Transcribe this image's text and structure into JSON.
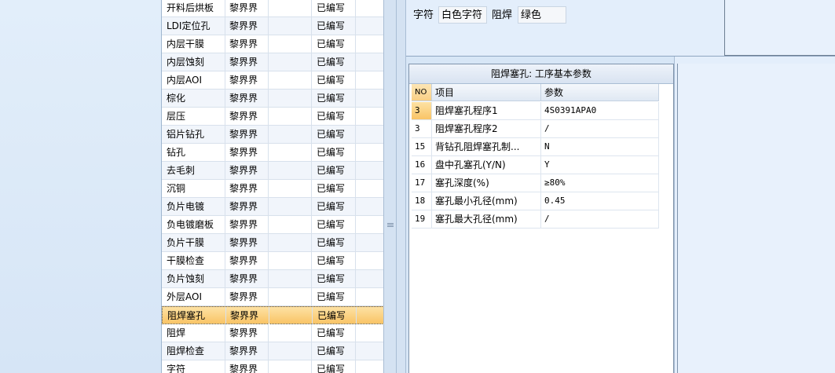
{
  "process_list": {
    "rows": [
      {
        "name": "开料后烘板",
        "user": "黎界界",
        "blank": "",
        "status": "已编写"
      },
      {
        "name": "LDI定位孔",
        "user": "黎界界",
        "blank": "",
        "status": "已编写"
      },
      {
        "name": "内层干膜",
        "user": "黎界界",
        "blank": "",
        "status": "已编写"
      },
      {
        "name": "内层蚀刻",
        "user": "黎界界",
        "blank": "",
        "status": "已编写"
      },
      {
        "name": "内层AOI",
        "user": "黎界界",
        "blank": "",
        "status": "已编写"
      },
      {
        "name": "棕化",
        "user": "黎界界",
        "blank": "",
        "status": "已编写"
      },
      {
        "name": "层压",
        "user": "黎界界",
        "blank": "",
        "status": "已编写"
      },
      {
        "name": "铝片钻孔",
        "user": "黎界界",
        "blank": "",
        "status": "已编写"
      },
      {
        "name": "钻孔",
        "user": "黎界界",
        "blank": "",
        "status": "已编写"
      },
      {
        "name": "去毛刺",
        "user": "黎界界",
        "blank": "",
        "status": "已编写"
      },
      {
        "name": "沉铜",
        "user": "黎界界",
        "blank": "",
        "status": "已编写"
      },
      {
        "name": "负片电镀",
        "user": "黎界界",
        "blank": "",
        "status": "已编写"
      },
      {
        "name": "负电镀磨板",
        "user": "黎界界",
        "blank": "",
        "status": "已编写"
      },
      {
        "name": "负片干膜",
        "user": "黎界界",
        "blank": "",
        "status": "已编写"
      },
      {
        "name": "干膜检查",
        "user": "黎界界",
        "blank": "",
        "status": "已编写"
      },
      {
        "name": "负片蚀刻",
        "user": "黎界界",
        "blank": "",
        "status": "已编写"
      },
      {
        "name": "外层AOI",
        "user": "黎界界",
        "blank": "",
        "status": "已编写"
      },
      {
        "name": "阻焊塞孔",
        "user": "黎界界",
        "blank": "",
        "status": "已编写",
        "selected": true
      },
      {
        "name": "阻焊",
        "user": "黎界界",
        "blank": "",
        "status": "已编写"
      },
      {
        "name": "阻焊检查",
        "user": "黎界界",
        "blank": "",
        "status": "已编写"
      },
      {
        "name": "字符",
        "user": "黎界界",
        "blank": "",
        "status": "已编写"
      }
    ]
  },
  "top_panel": {
    "char_label": "字符",
    "char_value": "白色字符",
    "mask_label": "阻焊",
    "mask_value": "绿色"
  },
  "param_table": {
    "caption": "阻焊塞孔: 工序基本参数",
    "headers": {
      "no": "NO",
      "item": "项目",
      "value": "参数"
    },
    "rows": [
      {
        "no": "3",
        "item": "阻焊塞孔程序1",
        "value": "4S0391APA0",
        "current": true
      },
      {
        "no": "3",
        "item": "阻焊塞孔程序2",
        "value": "/"
      },
      {
        "no": "15",
        "item": "背钻孔阻焊塞孔制...",
        "value": "N"
      },
      {
        "no": "16",
        "item": "盘中孔塞孔(Y/N)",
        "value": "Y"
      },
      {
        "no": "17",
        "item": "塞孔深度(%)",
        "value": "≥80%"
      },
      {
        "no": "18",
        "item": "塞孔最小孔径(mm)",
        "value": "0.45"
      },
      {
        "no": "19",
        "item": "塞孔最大孔径(mm)",
        "value": "/"
      }
    ]
  }
}
